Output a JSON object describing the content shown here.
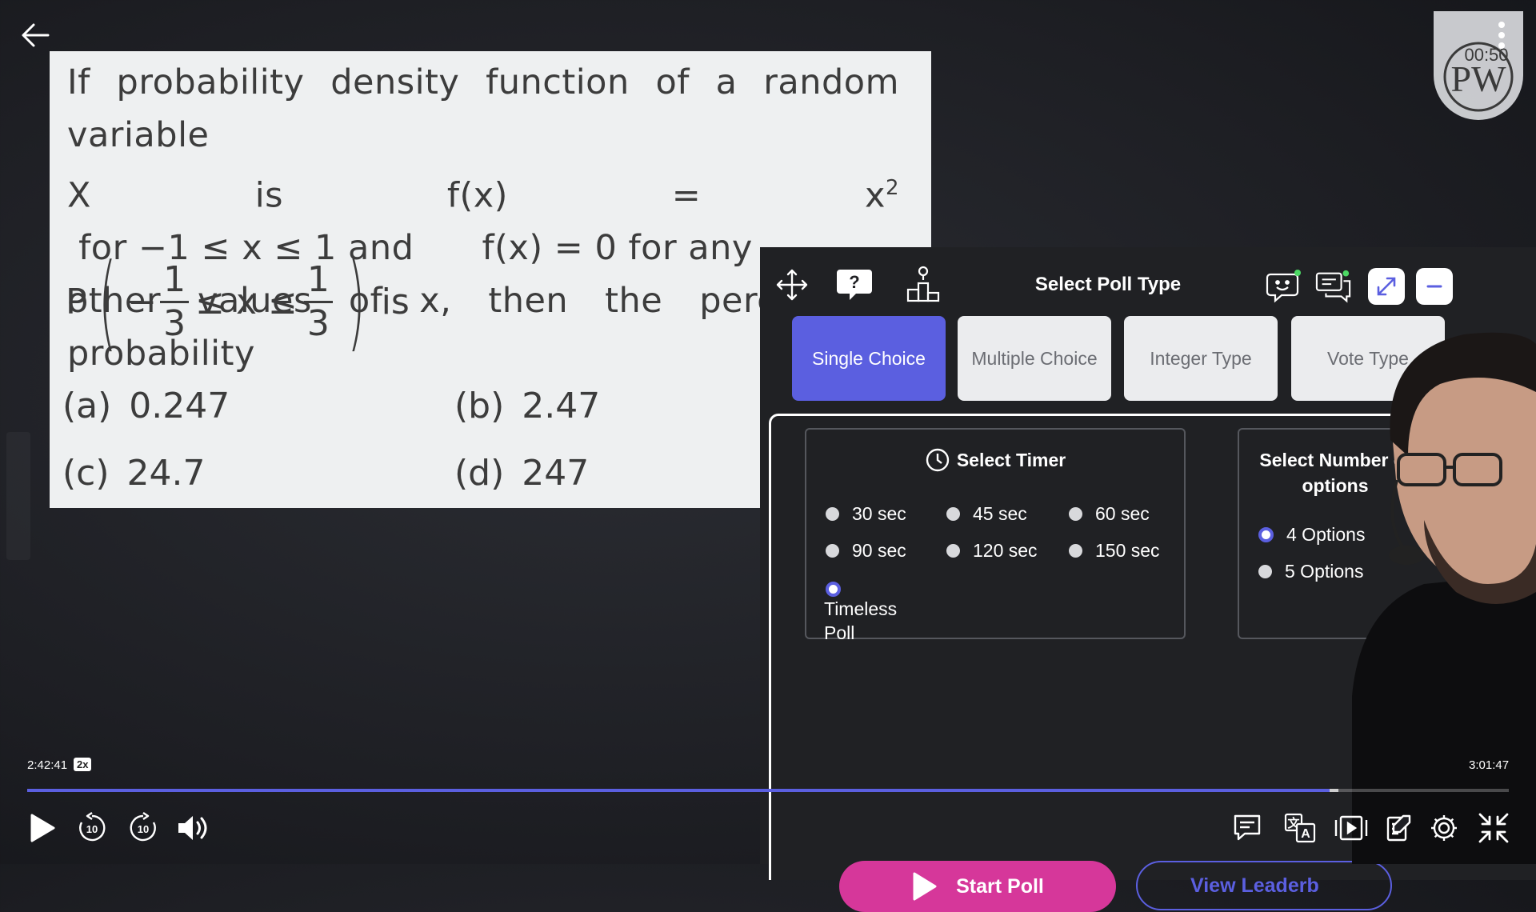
{
  "question": {
    "line1": "If probability density function of a random variable",
    "line2_pre": "X is f(x) = x",
    "line2_sup": "2",
    "line2_post": " for −1 ≤ x ≤ 1 and      f(x) = 0 for any",
    "line3": "other values of x, then the percentage probability",
    "expr_p": "P",
    "expr_minus": "−",
    "frac_num": "1",
    "frac_den": "3",
    "expr_le_x_le": "≤ x ≤",
    "expr_is": "is",
    "options": [
      {
        "label": "(a)",
        "value": "0.247"
      },
      {
        "label": "(b)",
        "value": "2.47"
      },
      {
        "label": "(c)",
        "value": "24.7"
      },
      {
        "label": "(d)",
        "value": "247"
      }
    ]
  },
  "poll": {
    "title": "Select Poll Type",
    "types": [
      "Single Choice",
      "Multiple Choice",
      "Integer Type",
      "Vote Type"
    ],
    "active_type": "Single Choice",
    "timer_title": "Select Timer",
    "timer_options": [
      "30 sec",
      "45 sec",
      "60 sec",
      "90 sec",
      "120 sec",
      "150 sec",
      "Timeless Poll"
    ],
    "selected_timer": "Timeless Poll",
    "num_options_title": "Select Number of options",
    "num_options": [
      "4 Options",
      "5 Options"
    ],
    "selected_num_options": "4 Options",
    "start_label": "Start Poll",
    "leaderboard_label": "View Leaderb"
  },
  "logo": {
    "text": "PW",
    "timer_overlay": "00:50"
  },
  "player": {
    "current_time": "2:42:41",
    "speed": "2x",
    "total_time": "3:01:47",
    "progress": 0.879,
    "buffered": 0.885,
    "skip_back_label": "10",
    "skip_fwd_label": "10"
  },
  "colors": {
    "accent": "#5b5fe0",
    "start_poll": "#d6379a",
    "panel": "#202124"
  }
}
